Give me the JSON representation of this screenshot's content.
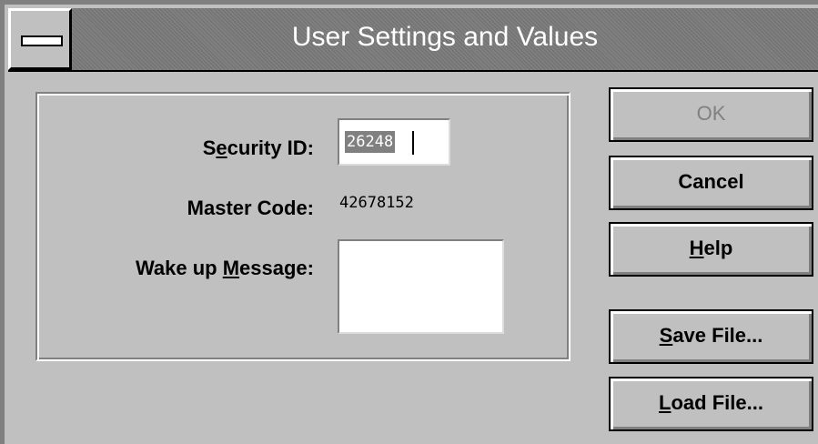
{
  "window": {
    "title": "User Settings and Values"
  },
  "form": {
    "security_id": {
      "label_pre": "S",
      "label_mn": "e",
      "label_post": "curity ID:",
      "value": "26248"
    },
    "master_code": {
      "label": "Master Code:",
      "value": "42678152"
    },
    "wake_up_message": {
      "label_pre": "Wake up ",
      "label_mn": "M",
      "label_post": "essage:",
      "value": ""
    }
  },
  "buttons": {
    "ok": {
      "label": "OK",
      "state": "disabled"
    },
    "cancel": {
      "label": "Cancel"
    },
    "help": {
      "mn": "H",
      "rest": "elp"
    },
    "save_file": {
      "mn": "S",
      "rest": "ave File..."
    },
    "load_file": {
      "mn": "L",
      "rest": "oad File..."
    }
  },
  "icons": [
    "system-menu-icon"
  ],
  "colors": {
    "face": "#c0c0c0",
    "titlebar": "#808080",
    "selection": "#808080",
    "disabled_text": "#808080"
  }
}
